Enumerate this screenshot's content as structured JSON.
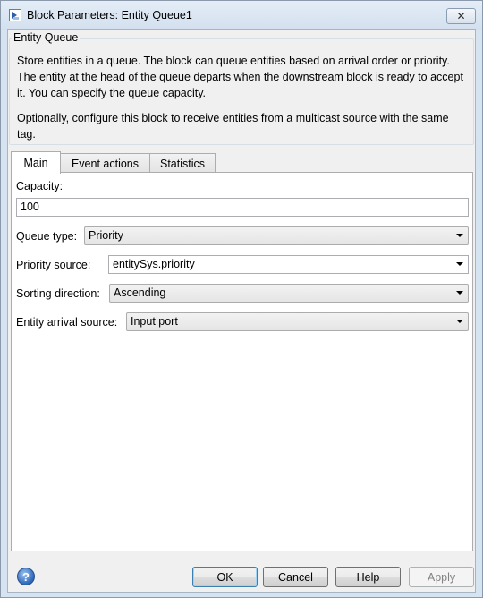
{
  "window": {
    "title": "Block Parameters: Entity Queue1",
    "close_label": "✕"
  },
  "description": {
    "group_title": "Entity Queue",
    "paragraphs": [
      "Store entities in a queue. The block can queue entities based on arrival order or priority. The entity at the head of the queue departs when the downstream block is ready to accept it. You can specify the queue capacity.",
      "Optionally, configure this block to receive entities from a multicast source with the same tag."
    ]
  },
  "tabs": [
    {
      "label": "Main",
      "active": true
    },
    {
      "label": "Event actions",
      "active": false
    },
    {
      "label": "Statistics",
      "active": false
    }
  ],
  "main": {
    "capacity_label": "Capacity:",
    "capacity_value": "100",
    "queue_type_label": "Queue type:",
    "queue_type_value": "Priority",
    "priority_source_label": "Priority source:",
    "priority_source_value": "entitySys.priority",
    "sorting_direction_label": "Sorting direction:",
    "sorting_direction_value": "Ascending",
    "entity_arrival_label": "Entity arrival source:",
    "entity_arrival_value": "Input port"
  },
  "footer": {
    "help_icon": "?",
    "ok_label": "OK",
    "cancel_label": "Cancel",
    "help_label": "Help",
    "apply_label": "Apply"
  }
}
